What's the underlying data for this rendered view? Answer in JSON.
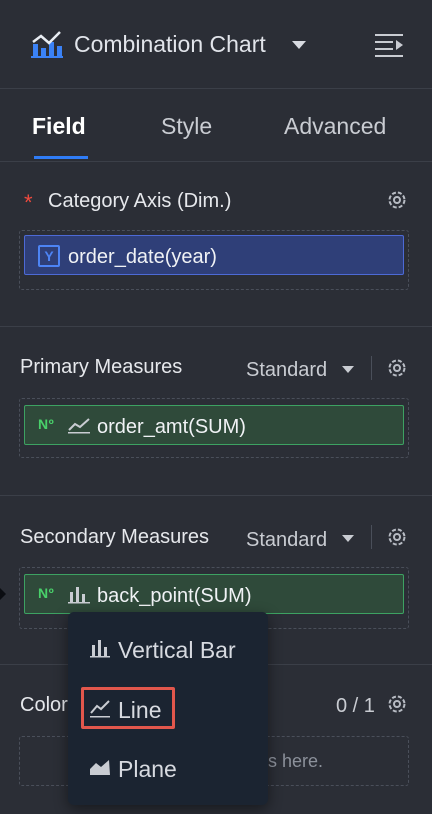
{
  "header": {
    "chart_icon": "line-chart-icon",
    "title": "Combination Chart",
    "menu_icon": "collapse-menu-icon"
  },
  "tabs": [
    {
      "label": "Field",
      "active": true
    },
    {
      "label": "Style",
      "active": false
    },
    {
      "label": "Advanced",
      "active": false
    }
  ],
  "category_axis": {
    "required_mark": "*",
    "label": "Category Axis (Dim.)",
    "field": {
      "type_badge": "Y",
      "name": "order_date(year)"
    }
  },
  "primary_measures": {
    "label": "Primary Measures",
    "mode": "Standard",
    "field": {
      "type_badge": "Nº",
      "chart_icon": "line-icon",
      "name": "order_amt(SUM)"
    }
  },
  "secondary_measures": {
    "label": "Secondary Measures",
    "mode": "Standard",
    "field": {
      "type_badge": "Nº",
      "chart_icon": "bar-icon",
      "name": "back_point(SUM)"
    }
  },
  "color": {
    "label": "Color",
    "count": "0 / 1",
    "drop_hint": "ds here."
  },
  "dropdown": {
    "items": [
      {
        "icon": "vertical-bar-icon",
        "label": "Vertical Bar"
      },
      {
        "icon": "line-icon",
        "label": "Line",
        "highlighted": true
      },
      {
        "icon": "plane-icon",
        "label": "Plane"
      }
    ]
  },
  "colors": {
    "background": "#2b2e36",
    "accent": "#2f7cf6",
    "highlight": "#e2574c",
    "measure_green": "#3da262",
    "dimension_blue": "#4d6ad6"
  }
}
